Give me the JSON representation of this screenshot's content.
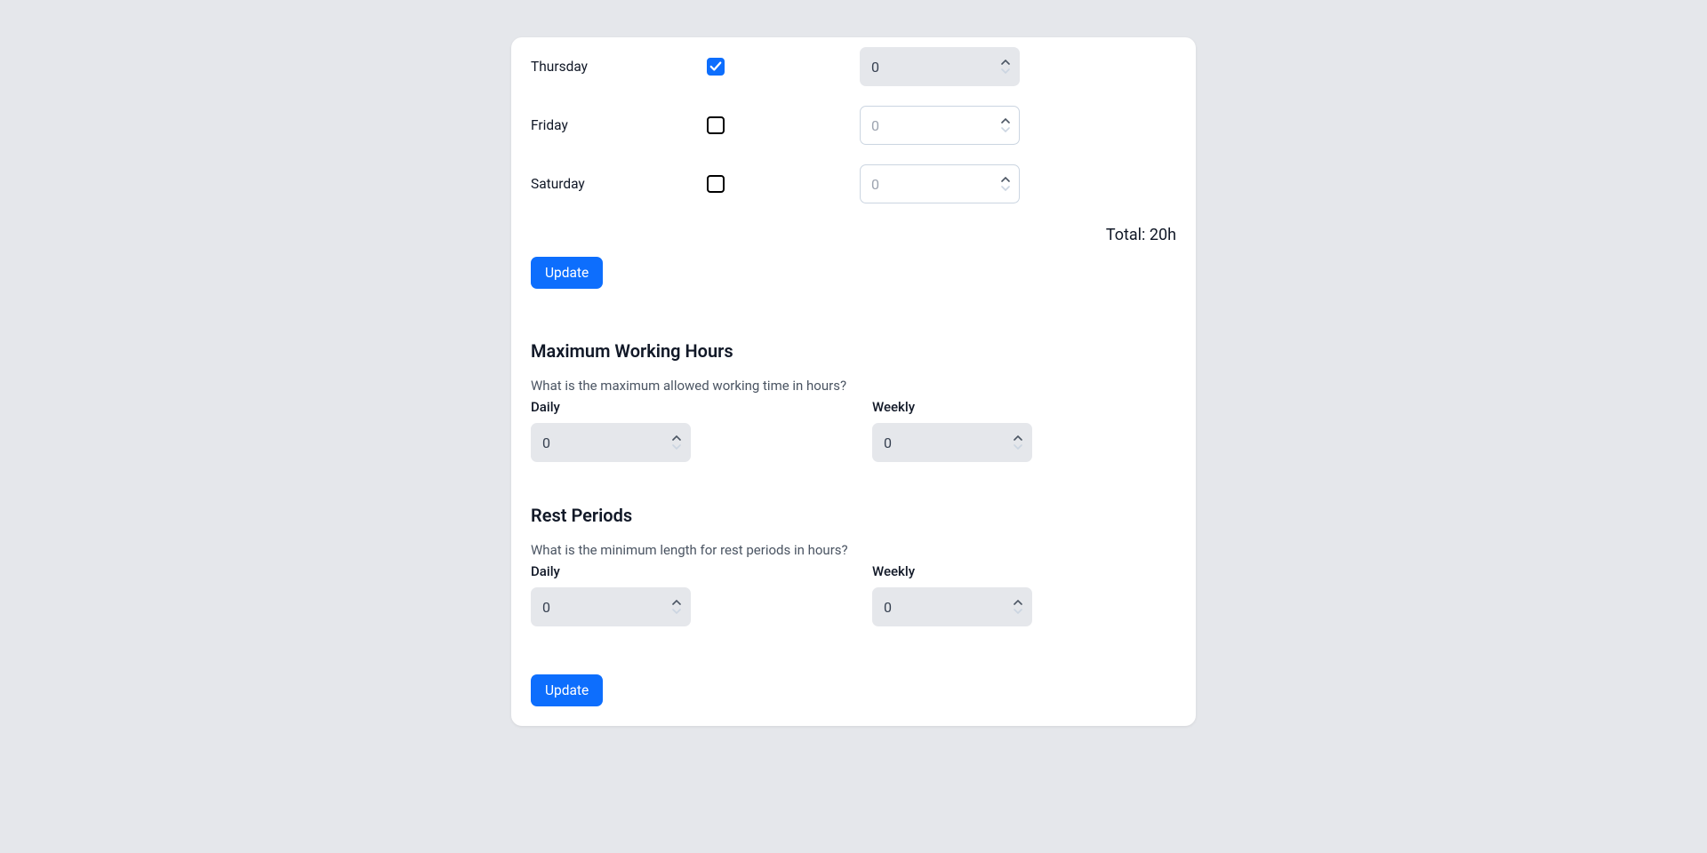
{
  "days": [
    {
      "label": "Thursday",
      "checked": true,
      "value": "0",
      "disabled": true,
      "placeholder": "0"
    },
    {
      "label": "Friday",
      "checked": false,
      "value": "",
      "disabled": false,
      "placeholder": "0"
    },
    {
      "label": "Saturday",
      "checked": false,
      "value": "",
      "disabled": false,
      "placeholder": "0"
    }
  ],
  "total_label": "Total: 20h",
  "update_button": "Update",
  "max_hours": {
    "heading": "Maximum Working Hours",
    "sub": "What is the maximum allowed working time in hours?",
    "daily_label": "Daily",
    "weekly_label": "Weekly",
    "daily_value": "0",
    "weekly_value": "0"
  },
  "rest": {
    "heading": "Rest Periods",
    "sub": "What is the minimum length for rest periods in hours?",
    "daily_label": "Daily",
    "weekly_label": "Weekly",
    "daily_value": "0",
    "weekly_value": "0"
  }
}
